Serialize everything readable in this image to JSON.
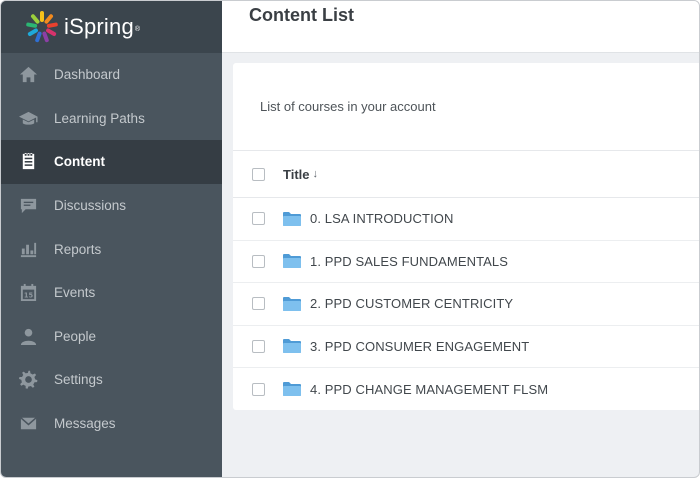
{
  "brand": {
    "name": "iSpring",
    "reg": "®"
  },
  "sidebar": {
    "items": [
      {
        "label": "Dashboard",
        "icon": "home-icon",
        "active": false
      },
      {
        "label": "Learning Paths",
        "icon": "graduation-cap-icon",
        "active": false
      },
      {
        "label": "Content",
        "icon": "clipboard-list-icon",
        "active": true
      },
      {
        "label": "Discussions",
        "icon": "chat-bubble-icon",
        "active": false
      },
      {
        "label": "Reports",
        "icon": "bar-chart-icon",
        "active": false
      },
      {
        "label": "Events",
        "icon": "calendar-icon",
        "active": false
      },
      {
        "label": "People",
        "icon": "person-icon",
        "active": false
      },
      {
        "label": "Settings",
        "icon": "gear-icon",
        "active": false
      },
      {
        "label": "Messages",
        "icon": "envelope-icon",
        "active": false
      }
    ]
  },
  "header": {
    "title": "Content List"
  },
  "card": {
    "description": "List of courses in your account",
    "column_title": "Title",
    "sort_indicator": "↓"
  },
  "courses": [
    {
      "name": "0. LSA INTRODUCTION"
    },
    {
      "name": "1. PPD SALES FUNDAMENTALS"
    },
    {
      "name": "2. PPD CUSTOMER CENTRICITY"
    },
    {
      "name": "3. PPD CONSUMER ENGAGEMENT"
    },
    {
      "name": "4. PPD CHANGE MANAGEMENT FLSM"
    }
  ],
  "colors": {
    "sidebar_bg": "#4a555e",
    "sidebar_active_bg": "#353d44",
    "logo_bg": "#3b454d",
    "folder_blue": "#5fa8e0",
    "content_bg": "#eef0f3"
  }
}
